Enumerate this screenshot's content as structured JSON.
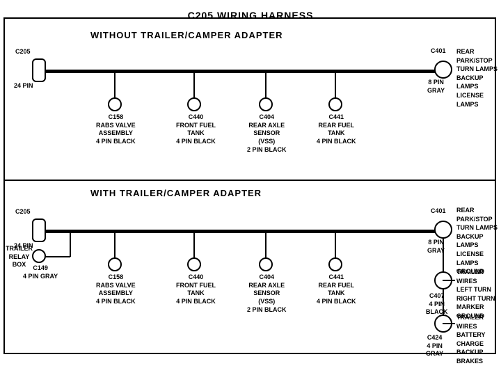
{
  "title": "C205 WIRING HARNESS",
  "section1": {
    "label": "WITHOUT  TRAILER/CAMPER  ADAPTER",
    "connectors": [
      {
        "id": "C205_top",
        "label": "C205\n24 PIN",
        "type": "rect"
      },
      {
        "id": "C401_top",
        "label": "C401\n8 PIN\nGRAY",
        "type": "circle"
      },
      {
        "id": "C158_top",
        "label": "C158\nRABS VALVE\nASSEMBLY\n4 PIN BLACK",
        "type": "circle"
      },
      {
        "id": "C440_top",
        "label": "C440\nFRONT FUEL\nTANK\n4 PIN BLACK",
        "type": "circle"
      },
      {
        "id": "C404_top",
        "label": "C404\nREAR AXLE\nSENSOR\n(VSS)\n2 PIN BLACK",
        "type": "circle"
      },
      {
        "id": "C441_top",
        "label": "C441\nREAR FUEL\nTANK\n4 PIN BLACK",
        "type": "circle"
      }
    ],
    "right_label": "REAR PARK/STOP\nTURN LAMPS\nBACKUP LAMPS\nLICENSE LAMPS"
  },
  "section2": {
    "label": "WITH  TRAILER/CAMPER  ADAPTER",
    "connectors": [
      {
        "id": "C205_bot",
        "label": "C205\n24 PIN",
        "type": "rect"
      },
      {
        "id": "C401_bot",
        "label": "C401\n8 PIN\nGRAY",
        "type": "circle"
      },
      {
        "id": "C158_bot",
        "label": "C158\nRABS VALVE\nASSEMBLY\n4 PIN BLACK",
        "type": "circle"
      },
      {
        "id": "C440_bot",
        "label": "C440\nFRONT FUEL\nTANK\n4 PIN BLACK",
        "type": "circle"
      },
      {
        "id": "C404_bot",
        "label": "C404\nREAR AXLE\nSENSOR\n(VSS)\n2 PIN BLACK",
        "type": "circle"
      },
      {
        "id": "C441_bot",
        "label": "C441\nREAR FUEL\nTANK\n4 PIN BLACK",
        "type": "circle"
      },
      {
        "id": "C149",
        "label": "C149\n4 PIN GRAY",
        "type": "circle"
      },
      {
        "id": "C407",
        "label": "C407\n4 PIN\nBLACK",
        "type": "circle"
      },
      {
        "id": "C424",
        "label": "C424\n4 PIN\nGRAY",
        "type": "circle"
      }
    ],
    "right_label1": "REAR PARK/STOP\nTURN LAMPS\nBACKUP LAMPS\nLICENSE LAMPS\nGROUND",
    "right_label2": "TRAILER WIRES\nLEFT TURN\nRIGHT TURN\nMARKER\nGROUND",
    "right_label3": "TRAILER WIRES\nBATTERY CHARGE\nBACKUP\nBRAKES",
    "left_label": "TRAILER\nRELAY\nBOX"
  }
}
